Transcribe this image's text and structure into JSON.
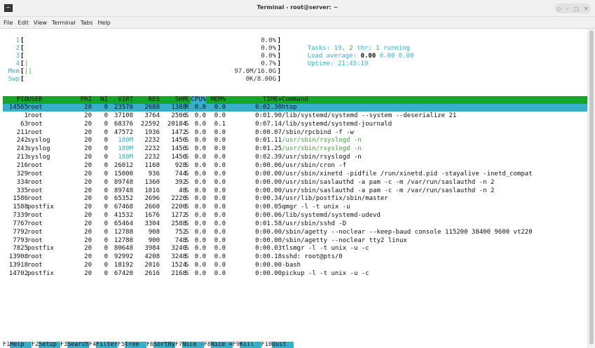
{
  "window": {
    "title": "Terminal - root@server: ~",
    "controls": [
      "◇",
      "–",
      "▢",
      "✕"
    ]
  },
  "menubar": [
    "File",
    "Edit",
    "View",
    "Terminal",
    "Tabs",
    "Help"
  ],
  "meters": {
    "cpus": [
      {
        "label": "1",
        "bar": "",
        "value": "0.0%"
      },
      {
        "label": "2",
        "bar": "",
        "value": "0.0%"
      },
      {
        "label": "3",
        "bar": "",
        "value": "0.0%"
      },
      {
        "label": "4",
        "bar": "|",
        "value": "0.7%"
      }
    ],
    "mem": {
      "label": "Mem",
      "bar": "||",
      "value": "97.0M/16.0G"
    },
    "swp": {
      "label": "Swp",
      "bar": "",
      "value": "0K/8.00G"
    }
  },
  "summary": {
    "tasks_label": "Tasks:",
    "tasks": "19",
    "thr": "2",
    "thr_label": "thr;",
    "running": "1",
    "running_label": "running",
    "load_label": "Load average:",
    "load1": "0.00",
    "load5": "0.00",
    "load15": "0.00",
    "uptime_label": "Uptime:",
    "uptime": "21:45:19"
  },
  "columns": [
    "PID",
    "USER",
    "PRI",
    "NI",
    "VIRT",
    "RES",
    "SHR",
    "S",
    "CPU%",
    "MEM%",
    "TIME+",
    "Command"
  ],
  "sort_column": "CPU%",
  "processes": [
    {
      "pid": "14565",
      "user": "root",
      "pri": "20",
      "ni": "0",
      "virt": "23576",
      "res": "2688",
      "shr": "1388",
      "s": "R",
      "cpu": "0.0",
      "mem": "0.0",
      "time": "0:02.30",
      "cmd": "htop",
      "selected": true
    },
    {
      "pid": "1",
      "user": "root",
      "pri": "20",
      "ni": "0",
      "virt": "37108",
      "res": "3764",
      "shr": "2500",
      "s": "S",
      "cpu": "0.0",
      "mem": "0.0",
      "time": "0:01.90",
      "cmd": "/lib/systemd/systemd --system --deserialize 21"
    },
    {
      "pid": "63",
      "user": "root",
      "pri": "20",
      "ni": "0",
      "virt": "68376",
      "res": "22592",
      "shr": "20184",
      "s": "S",
      "cpu": "0.0",
      "mem": "0.1",
      "time": "0:07.14",
      "cmd": "/lib/systemd/systemd-journald"
    },
    {
      "pid": "211",
      "user": "root",
      "pri": "20",
      "ni": "0",
      "virt": "47572",
      "res": "1936",
      "shr": "1472",
      "s": "S",
      "cpu": "0.0",
      "mem": "0.0",
      "time": "0:00.07",
      "cmd": "/sbin/rpcbind -f -w"
    },
    {
      "pid": "242",
      "user": "syslog",
      "pri": "20",
      "ni": "0",
      "virt": "180M",
      "res": "2232",
      "shr": "1456",
      "s": "S",
      "cpu": "0.0",
      "mem": "0.0",
      "time": "0:01.11",
      "cmd": "/usr/sbin/rsyslogd -n",
      "thread": true
    },
    {
      "pid": "243",
      "user": "syslog",
      "pri": "20",
      "ni": "0",
      "virt": "180M",
      "res": "2232",
      "shr": "1456",
      "s": "S",
      "cpu": "0.0",
      "mem": "0.0",
      "time": "0:01.25",
      "cmd": "/usr/sbin/rsyslogd -n",
      "thread": true
    },
    {
      "pid": "213",
      "user": "syslog",
      "pri": "20",
      "ni": "0",
      "virt": "180M",
      "res": "2232",
      "shr": "1456",
      "s": "S",
      "cpu": "0.0",
      "mem": "0.0",
      "time": "0:02.39",
      "cmd": "/usr/sbin/rsyslogd -n"
    },
    {
      "pid": "216",
      "user": "root",
      "pri": "20",
      "ni": "0",
      "virt": "26012",
      "res": "1168",
      "shr": "928",
      "s": "S",
      "cpu": "0.0",
      "mem": "0.0",
      "time": "0:00.06",
      "cmd": "/usr/sbin/cron -f"
    },
    {
      "pid": "329",
      "user": "root",
      "pri": "20",
      "ni": "0",
      "virt": "15000",
      "res": "936",
      "shr": "744",
      "s": "S",
      "cpu": "0.0",
      "mem": "0.0",
      "time": "0:00.00",
      "cmd": "/usr/sbin/xinetd -pidfile /run/xinetd.pid -stayalive -inetd_compat"
    },
    {
      "pid": "334",
      "user": "root",
      "pri": "20",
      "ni": "0",
      "virt": "89748",
      "res": "1360",
      "shr": "392",
      "s": "S",
      "cpu": "0.0",
      "mem": "0.0",
      "time": "0:00.00",
      "cmd": "/usr/sbin/saslauthd -a pam -c -m /var/run/saslauthd -n 2"
    },
    {
      "pid": "335",
      "user": "root",
      "pri": "20",
      "ni": "0",
      "virt": "89748",
      "res": "1016",
      "shr": "48",
      "s": "S",
      "cpu": "0.0",
      "mem": "0.0",
      "time": "0:00.00",
      "cmd": "/usr/sbin/saslauthd -a pam -c -m /var/run/saslauthd -n 2"
    },
    {
      "pid": "1586",
      "user": "root",
      "pri": "20",
      "ni": "0",
      "virt": "65352",
      "res": "2696",
      "shr": "2220",
      "s": "S",
      "cpu": "0.0",
      "mem": "0.0",
      "time": "0:00.34",
      "cmd": "/usr/lib/postfix/sbin/master"
    },
    {
      "pid": "1588",
      "user": "postfix",
      "pri": "20",
      "ni": "0",
      "virt": "67468",
      "res": "2660",
      "shr": "2200",
      "s": "S",
      "cpu": "0.0",
      "mem": "0.0",
      "time": "0:00.05",
      "cmd": "qmgr -l -t unix -u"
    },
    {
      "pid": "7339",
      "user": "root",
      "pri": "20",
      "ni": "0",
      "virt": "41532",
      "res": "1676",
      "shr": "1272",
      "s": "S",
      "cpu": "0.0",
      "mem": "0.0",
      "time": "0:00.06",
      "cmd": "/lib/systemd/systemd-udevd"
    },
    {
      "pid": "7767",
      "user": "root",
      "pri": "20",
      "ni": "0",
      "virt": "65464",
      "res": "3304",
      "shr": "2588",
      "s": "S",
      "cpu": "0.0",
      "mem": "0.0",
      "time": "0:01.58",
      "cmd": "/usr/sbin/sshd -D"
    },
    {
      "pid": "7792",
      "user": "root",
      "pri": "20",
      "ni": "0",
      "virt": "12788",
      "res": "908",
      "shr": "752",
      "s": "S",
      "cpu": "0.0",
      "mem": "0.0",
      "time": "0:00.00",
      "cmd": "/sbin/agetty --noclear --keep-baud console 115200 38400 9600 vt220"
    },
    {
      "pid": "7793",
      "user": "root",
      "pri": "20",
      "ni": "0",
      "virt": "12788",
      "res": "900",
      "shr": "748",
      "s": "S",
      "cpu": "0.0",
      "mem": "0.0",
      "time": "0:00.00",
      "cmd": "/sbin/agetty --noclear tty2 linux"
    },
    {
      "pid": "7825",
      "user": "postfix",
      "pri": "20",
      "ni": "0",
      "virt": "80648",
      "res": "3984",
      "shr": "3240",
      "s": "S",
      "cpu": "0.0",
      "mem": "0.0",
      "time": "0:00.03",
      "cmd": "tlsmgr -l -t unix -u -c"
    },
    {
      "pid": "13908",
      "user": "root",
      "pri": "20",
      "ni": "0",
      "virt": "92992",
      "res": "4208",
      "shr": "3248",
      "s": "S",
      "cpu": "0.0",
      "mem": "0.0",
      "time": "0:00.18",
      "cmd": "sshd: root@pts/0"
    },
    {
      "pid": "13918",
      "user": "root",
      "pri": "20",
      "ni": "0",
      "virt": "18192",
      "res": "2016",
      "shr": "1524",
      "s": "S",
      "cpu": "0.0",
      "mem": "0.0",
      "time": "0:00.00",
      "cmd": "-bash"
    },
    {
      "pid": "14702",
      "user": "postfix",
      "pri": "20",
      "ni": "0",
      "virt": "67420",
      "res": "2616",
      "shr": "2168",
      "s": "S",
      "cpu": "0.0",
      "mem": "0.0",
      "time": "0:00.00",
      "cmd": "pickup -l -t unix -u -c"
    }
  ],
  "function_keys": [
    {
      "key": "F1",
      "label": "Help  "
    },
    {
      "key": "F2",
      "label": "Setup "
    },
    {
      "key": "F3",
      "label": "Search"
    },
    {
      "key": "F4",
      "label": "Filter"
    },
    {
      "key": "F5",
      "label": "Tree  "
    },
    {
      "key": "F6",
      "label": "SortBy"
    },
    {
      "key": "F7",
      "label": "Nice -"
    },
    {
      "key": "F8",
      "label": "Nice +"
    },
    {
      "key": "F9",
      "label": "Kill  "
    },
    {
      "key": "F10",
      "label": "Quit  "
    }
  ],
  "colors": {
    "header_bg": "#16a52a",
    "selected_bg": "#34b0c8",
    "accent_cyan": "#34b0c8",
    "accent_green": "#3aa83a"
  }
}
